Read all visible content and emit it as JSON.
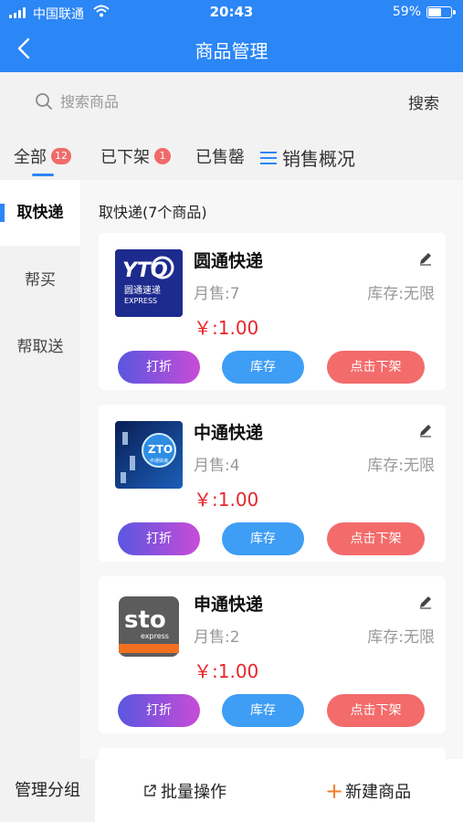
{
  "status_bar": {
    "carrier": "中国联通",
    "time": "20:43",
    "battery": "59%",
    "battery_level": 0.59
  },
  "nav": {
    "title": "商品管理",
    "back_icon": "chevron-left-icon"
  },
  "search": {
    "placeholder": "搜索商品",
    "button": "搜索"
  },
  "tabs": [
    {
      "label": "全部",
      "badge": "12",
      "active": true
    },
    {
      "label": "已下架",
      "badge": "1"
    },
    {
      "label": "已售罄"
    },
    {
      "label": "销售概况",
      "icon": "menu-icon"
    }
  ],
  "sidebar": {
    "items": [
      {
        "label": "取快递",
        "active": true
      },
      {
        "label": "帮买"
      },
      {
        "label": "帮取送"
      }
    ]
  },
  "section_title": "取快递(7个商品)",
  "products": [
    {
      "name": "圆通快递",
      "sold": "月售:7",
      "stock": "库存:无限",
      "price": "￥:1.00",
      "logo_text": "YTO",
      "logo_sub": "圆通速递",
      "logo_sub2": "EXPRESS"
    },
    {
      "name": "中通快递",
      "sold": "月售:4",
      "stock": "库存:无限",
      "price": "￥:1.00",
      "logo_text": "ZTO",
      "logo_sub": "中通快递"
    },
    {
      "name": "申通快递",
      "sold": "月售:2",
      "stock": "库存:无限",
      "price": "￥:1.00",
      "logo_text": "sto",
      "logo_sub": "express"
    }
  ],
  "card_buttons": {
    "discount": "打折",
    "inventory": "库存",
    "delist": "点击下架"
  },
  "bottom": {
    "group": "管理分组",
    "batch": "批量操作",
    "new_item": "新建商品"
  },
  "colors": {
    "primary": "#2b86f6",
    "price": "#e8252b",
    "badge": "#f06a6a",
    "delist": "#f36b6b",
    "inventory": "#3e9df5"
  }
}
